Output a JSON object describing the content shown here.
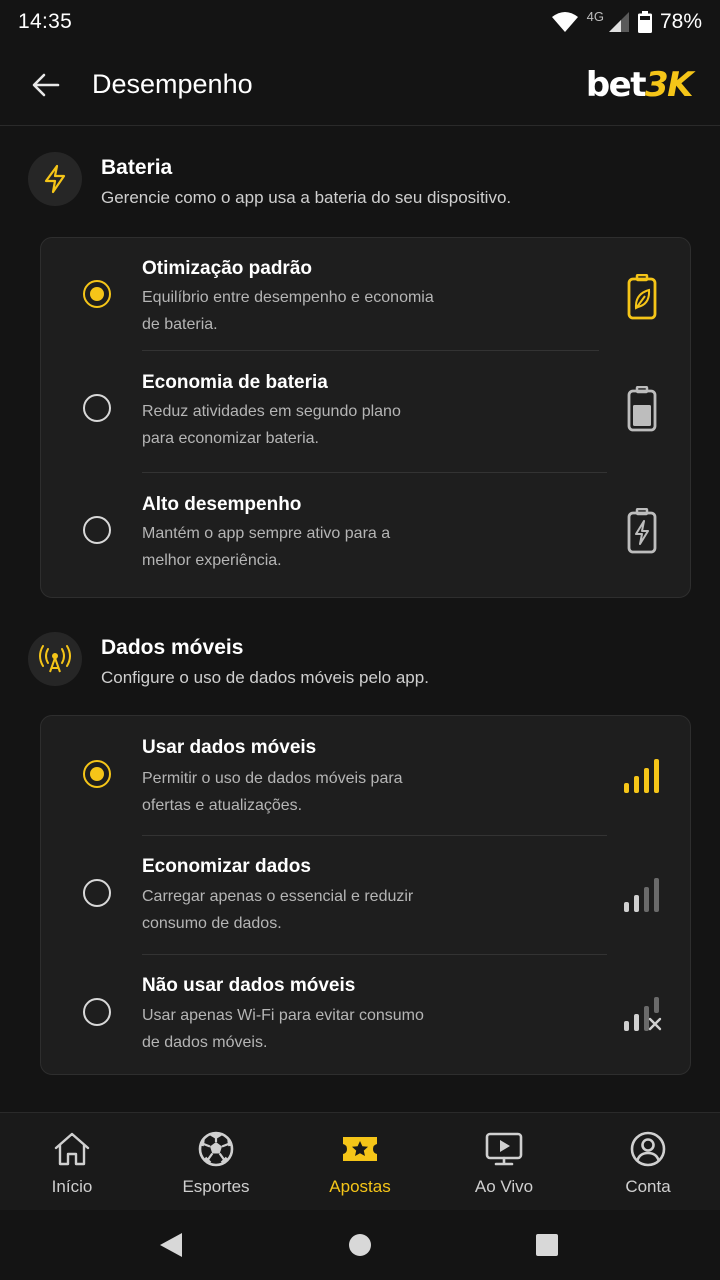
{
  "status": {
    "time": "14:35",
    "network": "4G",
    "battery_pct": "78%",
    "icons": [
      "wifi-icon",
      "cell-signal-icon",
      "battery-icon"
    ]
  },
  "app_bar": {
    "title": "Desempenho",
    "brand_part1": "bet",
    "brand_part2": "3K"
  },
  "battery_section": {
    "title": "Bateria",
    "subtitle": "Gerencie como o app usa a bateria do seu dispositivo.",
    "icon": "lightning-icon",
    "options": [
      {
        "title": "Otimização padrão",
        "line1": "Equilíbrio entre desempenho e economia",
        "line2": "de bateria.",
        "selected": true,
        "icon": "battery-leaf-icon"
      },
      {
        "title": "Economia de bateria",
        "line1": "Reduz atividades em segundo plano",
        "line2": "para economizar bateria.",
        "selected": false,
        "icon": "battery-half-icon"
      },
      {
        "title": "Alto desempenho",
        "line1": "Mantém o app sempre ativo para a",
        "line2": "melhor experiência.",
        "selected": false,
        "icon": "battery-charging-icon"
      }
    ]
  },
  "data_section": {
    "title": "Dados móveis",
    "subtitle": "Configure o uso de dados móveis pelo app.",
    "icon": "antenna-icon",
    "options": [
      {
        "title": "Usar dados móveis",
        "line1": "Permitir o uso de dados móveis para",
        "line2": "ofertas e atualizações.",
        "selected": true,
        "icon": "signal-full-icon"
      },
      {
        "title": "Economizar dados",
        "line1": "Carregar apenas o essencial e reduzir",
        "line2": "consumo de dados.",
        "selected": false,
        "icon": "signal-low-icon"
      },
      {
        "title": "Não usar dados móveis",
        "line1": "Usar apenas Wi-Fi para evitar consumo",
        "line2": "de dados móveis.",
        "selected": false,
        "icon": "signal-off-icon"
      }
    ]
  },
  "bottom_nav": [
    {
      "label": "Início",
      "icon": "home-icon",
      "active": false
    },
    {
      "label": "Esportes",
      "icon": "soccer-ball-icon",
      "active": false
    },
    {
      "label": "Apostas",
      "icon": "ticket-star-icon",
      "active": true
    },
    {
      "label": "Ao Vivo",
      "icon": "tv-play-icon",
      "active": false
    },
    {
      "label": "Conta",
      "icon": "user-circle-icon",
      "active": false
    }
  ],
  "colors": {
    "accent": "#f5c518",
    "background": "#141414",
    "card": "#1e1e1e",
    "text_secondary": "#b5b5b5"
  }
}
